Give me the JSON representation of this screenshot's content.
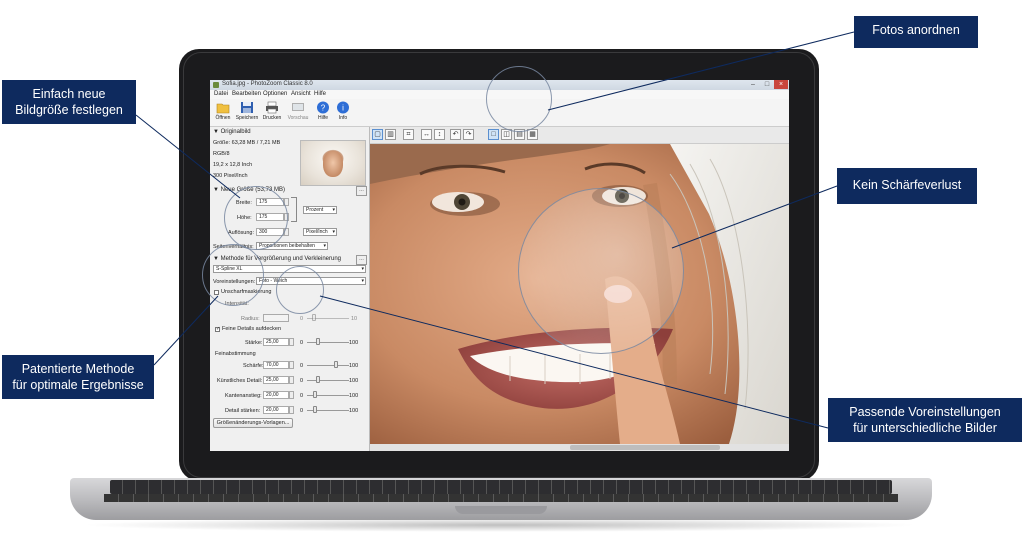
{
  "window": {
    "title": "Sofia.jpg - PhotoZoom Classic 8.0",
    "minimize": "–",
    "maximize": "□",
    "close": "×"
  },
  "menu": [
    "Datei",
    "Bearbeiten",
    "Optionen",
    "Ansicht",
    "Hilfe"
  ],
  "toolbar": [
    {
      "label": "Öffnen",
      "icon": "folder-icon"
    },
    {
      "label": "Speichern",
      "icon": "save-icon"
    },
    {
      "label": "Drucken",
      "icon": "printer-icon"
    },
    {
      "label": "Vorschau",
      "icon": "preview-icon"
    },
    {
      "label": "Hilfe",
      "icon": "help-icon"
    },
    {
      "label": "Info",
      "icon": "info-icon"
    }
  ],
  "original": {
    "header": "Originalbild",
    "size": "Größe: 63,28 MB / 7,21 MB",
    "mode": "RGB/8",
    "dims": "19,2 x 12,8 Inch",
    "res": "300 Pixel/Inch"
  },
  "new_size": {
    "header": "Neue Größe (53,73 MB)",
    "width_label": "Breite:",
    "width_value": "175",
    "height_label": "Höhe:",
    "height_value": "175",
    "res_label": "Auflösung:",
    "res_value": "300",
    "unit": "Prozent",
    "res_unit": "Pixel/Inch",
    "ratio_label": "Seitenverhältnis:",
    "ratio_value": "Proportionen beibehalten"
  },
  "method": {
    "header": "Methode für Vergrößerung und Verkleinerung",
    "algorithm": "S-Spline XL",
    "preset_label": "Voreinstellungen:",
    "preset_value": "Foto - Weich"
  },
  "unsharp": {
    "label": "Unscharfmaskierung",
    "intensity_label": "Intensität:",
    "radius_label": "Radius:",
    "radius_min": "0",
    "radius_max": "10"
  },
  "fine_details": {
    "label": "Feine Details aufdecken",
    "strength_label": "Stärke:",
    "strength_value": "25,00",
    "min": "0",
    "max": "100"
  },
  "fine_tuning": {
    "header": "Feinabstimmung",
    "rows": [
      {
        "label": "Schärfe:",
        "value": "70,00",
        "min": "0",
        "max": "100",
        "level": 0.7
      },
      {
        "label": "Künstliches Detail:",
        "value": "25,00",
        "min": "0",
        "max": "100",
        "level": 0.25
      },
      {
        "label": "Kantenanstieg:",
        "value": "20,00",
        "min": "0",
        "max": "100",
        "level": 0.2
      },
      {
        "label": "Detail stärken:",
        "value": "20,00",
        "min": "0",
        "max": "100",
        "level": 0.2
      }
    ],
    "templates_button": "Größenänderungs-Vorlagen..."
  },
  "callouts": {
    "resize": "Einfach neue\nBildgröße festlegen",
    "arrange": "Fotos anordnen",
    "sharpness": "Kein Schärfeverlust",
    "method": "Patentierte Methode\nfür optimale Ergebnisse",
    "presets": "Passende Voreinstellungen\nfür unterschiedliche Bilder"
  },
  "colors": {
    "callout": "#0e2a5e",
    "lens": "#7887a0"
  }
}
